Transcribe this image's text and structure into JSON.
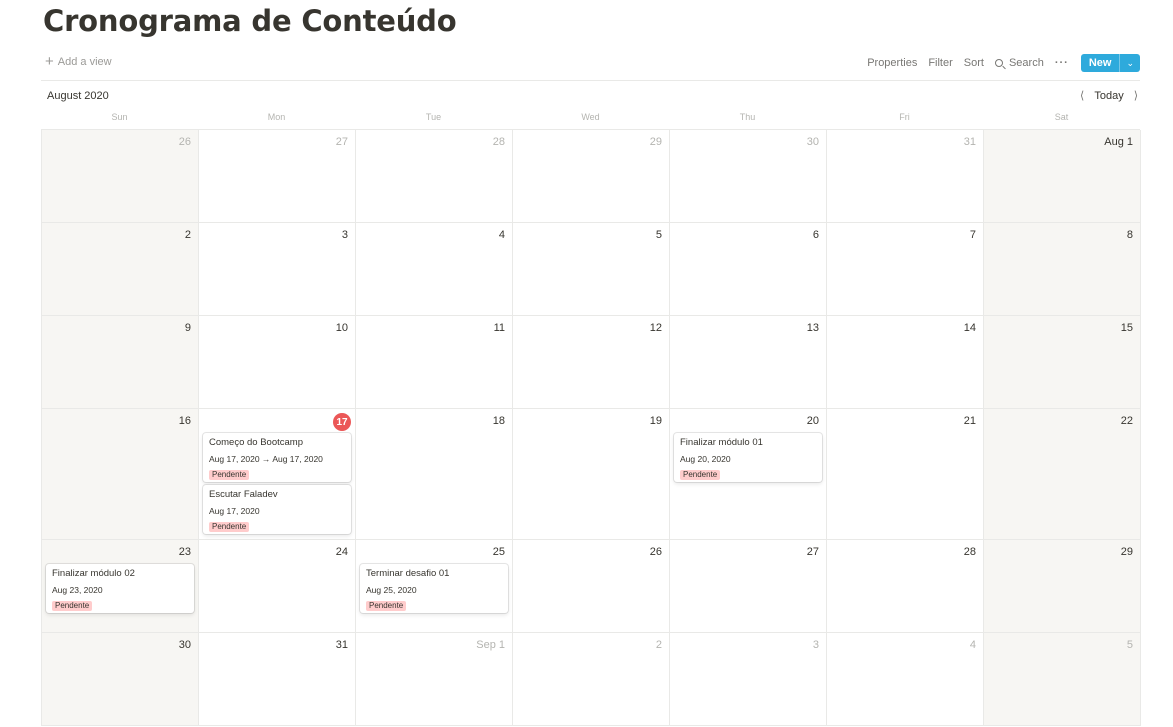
{
  "page": {
    "title": "Cronograma de Conteúdo"
  },
  "toolbar": {
    "add_view": "Add a view",
    "properties": "Properties",
    "filter": "Filter",
    "sort": "Sort",
    "search": "Search",
    "more": "···",
    "new": "New"
  },
  "calendar": {
    "month": "August 2020",
    "today": "Today",
    "weekdays": [
      "Sun",
      "Mon",
      "Tue",
      "Wed",
      "Thu",
      "Fri",
      "Sat"
    ],
    "weeks": [
      {
        "days": [
          {
            "label": "26",
            "muted": true
          },
          {
            "label": "27",
            "muted": true
          },
          {
            "label": "28",
            "muted": true
          },
          {
            "label": "29",
            "muted": true
          },
          {
            "label": "30",
            "muted": true
          },
          {
            "label": "31",
            "muted": true
          },
          {
            "label": "Aug 1",
            "muted": false
          }
        ]
      },
      {
        "days": [
          {
            "label": "2"
          },
          {
            "label": "3"
          },
          {
            "label": "4"
          },
          {
            "label": "5"
          },
          {
            "label": "6"
          },
          {
            "label": "7"
          },
          {
            "label": "8"
          }
        ]
      },
      {
        "days": [
          {
            "label": "9"
          },
          {
            "label": "10"
          },
          {
            "label": "11"
          },
          {
            "label": "12"
          },
          {
            "label": "13"
          },
          {
            "label": "14"
          },
          {
            "label": "15"
          }
        ]
      },
      {
        "days": [
          {
            "label": "16"
          },
          {
            "label": "17",
            "today": true,
            "events": [
              {
                "title": "Começo do Bootcamp",
                "date": "Aug 17, 2020 → Aug 17, 2020",
                "status": "Pendente"
              },
              {
                "title": "Escutar Faladev",
                "date": "Aug 17, 2020",
                "status": "Pendente"
              }
            ]
          },
          {
            "label": "18"
          },
          {
            "label": "19"
          },
          {
            "label": "20",
            "events": [
              {
                "title": "Finalizar módulo 01",
                "date": "Aug 20, 2020",
                "status": "Pendente"
              }
            ]
          },
          {
            "label": "21"
          },
          {
            "label": "22"
          }
        ]
      },
      {
        "days": [
          {
            "label": "23",
            "events": [
              {
                "title": "Finalizar módulo 02",
                "date": "Aug 23, 2020",
                "status": "Pendente"
              }
            ]
          },
          {
            "label": "24"
          },
          {
            "label": "25",
            "events": [
              {
                "title": "Terminar desafio 01",
                "date": "Aug 25, 2020",
                "status": "Pendente"
              }
            ]
          },
          {
            "label": "26"
          },
          {
            "label": "27"
          },
          {
            "label": "28"
          },
          {
            "label": "29"
          }
        ]
      },
      {
        "days": [
          {
            "label": "30"
          },
          {
            "label": "31"
          },
          {
            "label": "Sep 1",
            "muted": true
          },
          {
            "label": "2",
            "muted": true
          },
          {
            "label": "3",
            "muted": true
          },
          {
            "label": "4",
            "muted": true
          },
          {
            "label": "5",
            "muted": true
          }
        ]
      }
    ]
  },
  "colors": {
    "accent": "#2eaadc",
    "today": "#eb5757",
    "status_pendente": "#ffcccc",
    "weekend": "#f7f6f3"
  }
}
